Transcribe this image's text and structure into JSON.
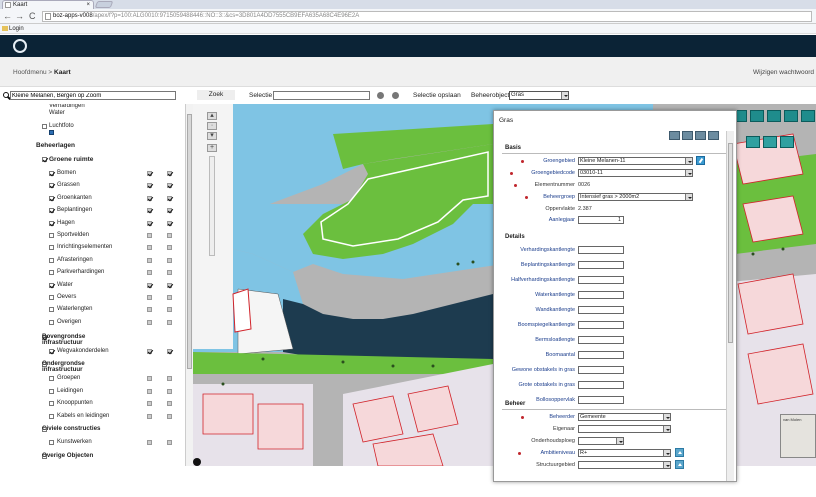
{
  "browser": {
    "tab_title": "Kaart",
    "tab_close": "×",
    "url_host": "boz-apps-v008",
    "url_path": "/apex/f?p=100:ALG0010:9715059488446::NO::3::&cs=3D801A4DD7555CB9EFA635A68C4E96E2A",
    "bookmark_label": "Login"
  },
  "header": {
    "breadcrumb_root": "Hoofdmenu",
    "breadcrumb_sep": " > ",
    "breadcrumb_current": "Kaart",
    "password_link": "Wijzigen wachtwoord"
  },
  "toolbar": {
    "search_value": "Kleine Melanen, Bergen op Zoom",
    "zoek_label": "Zoek",
    "selectie_label": "Selectie",
    "selectie_value": "",
    "selectie_opslaan_label": "Selectie opslaan",
    "beheerobject_label": "Beheerobject",
    "beheerobject_value": "Gras"
  },
  "layers": {
    "top_items": [
      {
        "label": "Verhardingen",
        "checked": true
      },
      {
        "label": "Water",
        "checked": true
      },
      {
        "label": "Luchtfoto",
        "checked": false
      }
    ],
    "beheerlagen_title": "Beheerlagen",
    "groene_ruimte_title": "Groene ruimte",
    "groene_items": [
      {
        "label": "Bomen",
        "checked": true,
        "c2": true,
        "c3": true
      },
      {
        "label": "Grassen",
        "checked": true,
        "c2": true,
        "c3": true
      },
      {
        "label": "Groenkanten",
        "checked": true,
        "c2": true,
        "c3": true
      },
      {
        "label": "Beplantingen",
        "checked": true,
        "c2": true,
        "c3": true
      },
      {
        "label": "Hagen",
        "checked": true,
        "c2": true,
        "c3": true
      },
      {
        "label": "Sportvelden",
        "checked": false,
        "c2": false,
        "c3": false
      },
      {
        "label": "Inrichtingselementen",
        "checked": false,
        "c2": false,
        "c3": false
      },
      {
        "label": "Afrasteringen",
        "checked": false,
        "c2": false,
        "c3": false
      },
      {
        "label": "Parkverhardingen",
        "checked": false,
        "c2": false,
        "c3": false
      },
      {
        "label": "Water",
        "checked": true,
        "c2": true,
        "c3": true
      },
      {
        "label": "Oevers",
        "checked": false,
        "c2": false,
        "c3": false
      },
      {
        "label": "Waterlengten",
        "checked": false,
        "c2": false,
        "c3": false
      },
      {
        "label": "Overigen",
        "checked": false,
        "c2": false,
        "c3": false
      }
    ],
    "bovengrondse_title": "Bovengrondse infrastructuur",
    "bovengrondse_items": [
      {
        "label": "Wegvakonderdelen",
        "checked": true,
        "c2": true,
        "c3": true
      }
    ],
    "ondergrondse_title": "Ondergrondse infrastructuur",
    "ondergrondse_items": [
      {
        "label": "Groepen",
        "checked": false,
        "c2": false,
        "c3": false
      },
      {
        "label": "Leidingen",
        "checked": false,
        "c2": false,
        "c3": false
      },
      {
        "label": "Knooppunten",
        "checked": false,
        "c2": false,
        "c3": false
      },
      {
        "label": "Kabels en leidingen",
        "checked": false,
        "c2": false,
        "c3": false
      }
    ],
    "civiele_title": "Civiele constructies",
    "civiele_items": [
      {
        "label": "Kunstwerken",
        "checked": false,
        "c2": false,
        "c3": false
      }
    ],
    "overige_title": "Overige Objecten"
  },
  "popup": {
    "title": "Gras",
    "close": "×",
    "basis_title": "Basis",
    "groengebied_label": "Groengebied",
    "groengebied_value": "Kleine Melanen-11",
    "groengebiedcode_label": "Groengebiedcode",
    "groengebiedcode_value": "03010-11",
    "elementnummer_label": "Elementnummer",
    "elementnummer_value": "0026",
    "beheergroep_label": "Beheergroep",
    "beheergroep_value": "Intensief gras > 2000m2",
    "oppervlakte_label": "Oppervlakte",
    "oppervlakte_value": "2.387",
    "aanlegjaar_label": "Aanlegjaar",
    "aanlegjaar_value": "1",
    "details_title": "Details",
    "details_fields": [
      "Verhardingskantlengte",
      "Beplantingskantlengte",
      "Halfverhardingskantlengte",
      "Waterkantlengte",
      "Wandkantlengte",
      "Boomspiegelkantlengte",
      "Bermsloatlengte",
      "Boomaantal",
      "Gewone obstakels in gras",
      "Grote obstakels in gras",
      "Bollosoppervlak"
    ],
    "beheer_title": "Beheer",
    "beheerder_label": "Beheerder",
    "beheerder_value": "Gemeente",
    "eigenaar_label": "Eigenaar",
    "eigenaar_value": "",
    "onderhoudsploeg_label": "Onderhoudsploeg",
    "onderhoudsploeg_value": "",
    "ambitieniveau_label": "Ambitieniveau",
    "ambitieniveau_value": "R+",
    "structuurgebied_label": "Structuurgebied",
    "structuurgebied_value": ""
  },
  "map": {
    "overview_label": "van Molen",
    "colors": {
      "water": "#7fc4e4",
      "green": "#6bbf3e",
      "road": "#b4b4b4",
      "dark_water": "#1d3b4f",
      "building_outline": "#d1232a",
      "lot": "#e7e2ea"
    }
  }
}
